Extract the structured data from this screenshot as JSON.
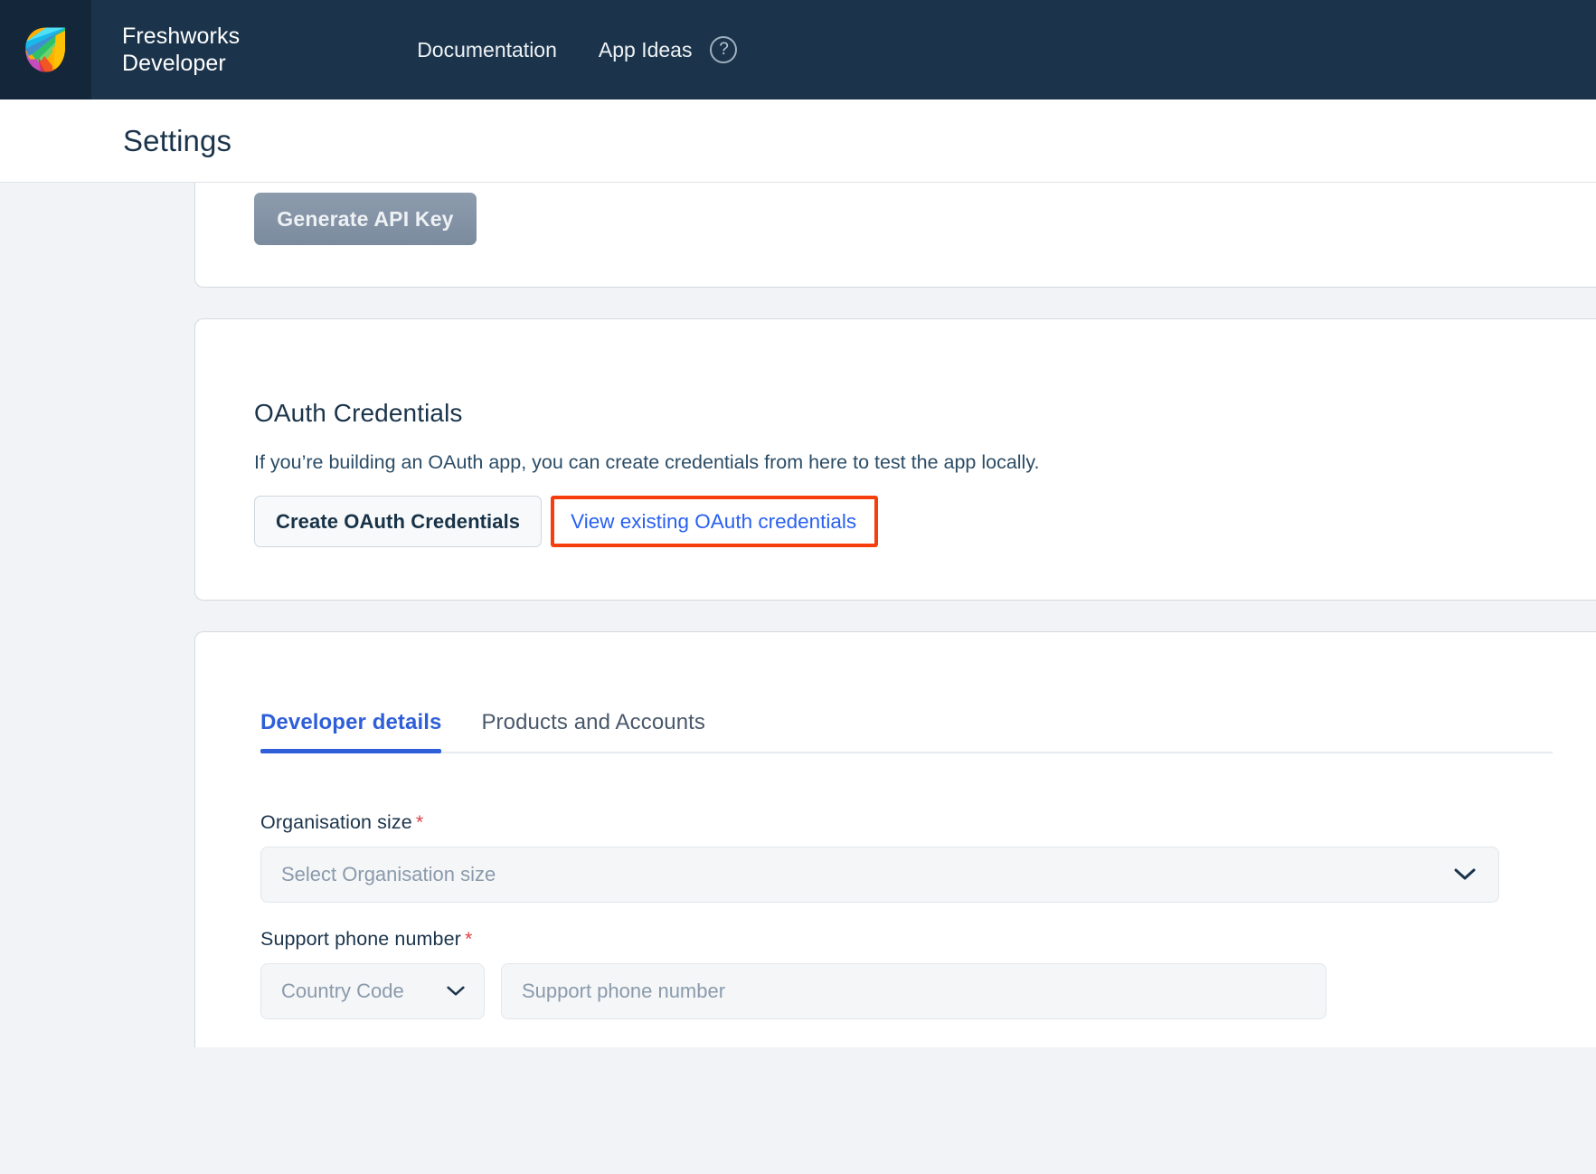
{
  "topbar": {
    "logo_icon": "freshworks-leaf-logo",
    "brand": "Freshworks\nDeveloper",
    "nav": [
      {
        "label": "Documentation",
        "name": "nav-documentation"
      },
      {
        "label": "App Ideas",
        "name": "nav-app-ideas"
      }
    ],
    "help_icon_glyph": "?",
    "background_color": "#1b344b",
    "logo_tile_color": "#14273a"
  },
  "page": {
    "title": "Settings"
  },
  "api_key_card": {
    "generate_button_label": "Generate API Key",
    "generate_button_disabled": true
  },
  "oauth_card": {
    "title": "OAuth Credentials",
    "description": "If you’re building an OAuth app, you can create credentials from here to test the app locally.",
    "create_button_label": "Create OAuth Credentials",
    "view_link_label": "View existing OAuth credentials",
    "highlight_color": "#f63d0c",
    "link_color": "#2960f0"
  },
  "details_card": {
    "tabs": [
      {
        "label": "Developer details",
        "active": true
      },
      {
        "label": "Products and Accounts",
        "active": false
      }
    ],
    "active_tab_color": "#2e5fd8",
    "fields": {
      "organisation_size": {
        "label": "Organisation size",
        "required_marker": "*",
        "placeholder": "Select Organisation size",
        "value": "",
        "chevron_icon": "chevron-down-icon"
      },
      "support_phone": {
        "label": "Support phone number",
        "required_marker": "*",
        "country_code_placeholder": "Country Code",
        "country_code_value": "",
        "phone_placeholder": "Support phone number",
        "phone_value": "",
        "chevron_icon": "chevron-down-icon"
      }
    }
  }
}
